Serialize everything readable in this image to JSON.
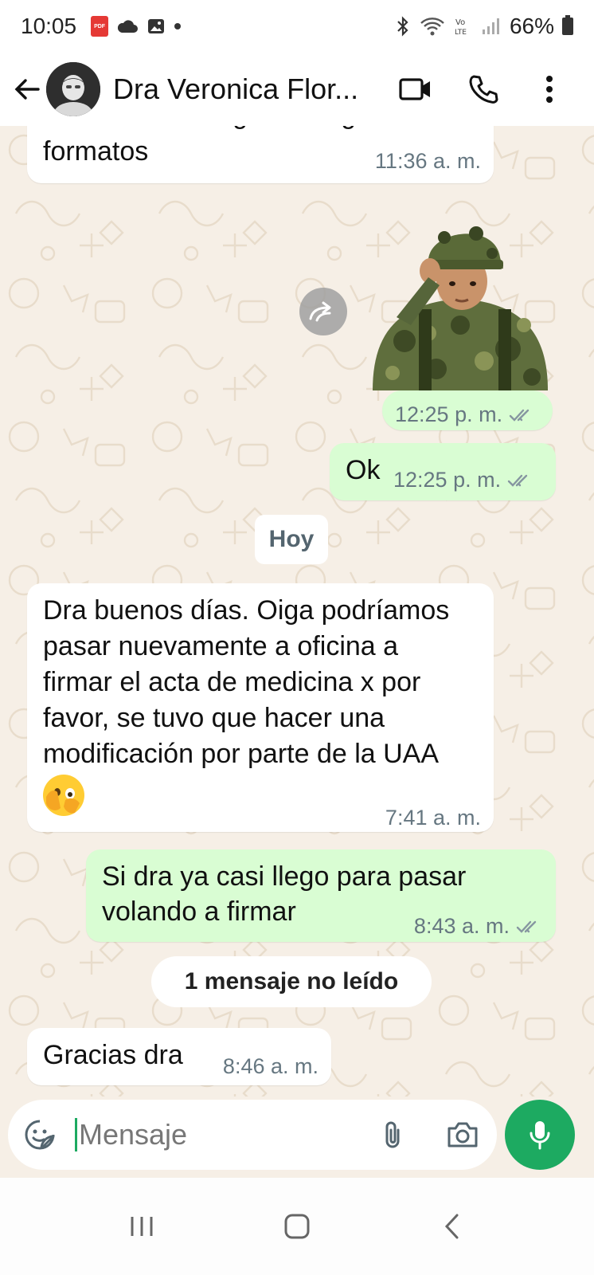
{
  "status_bar": {
    "time": "10:05",
    "battery": "66%"
  },
  "header": {
    "contact_name": "Dra Veronica Flor...",
    "accent_color": "#1daa61"
  },
  "messages": [
    {
      "direction": "incoming",
      "partial_top": "ustedes solo háganos llegar los",
      "text": "formatos",
      "time": "11:36 a. m."
    },
    {
      "direction": "outgoing",
      "type": "sticker",
      "sticker_icon": "saluting-child-soldier-sticker",
      "time": "12:25 p. m."
    },
    {
      "direction": "outgoing",
      "text": "Ok",
      "time": "12:25 p. m."
    },
    {
      "direction": "incoming",
      "lines": [
        "Dra buenos días. Oiga podríamos",
        "pasar nuevamente a oficina a",
        "firmar el acta de medicina x por",
        "favor, se tuvo que hacer una",
        "modificación por parte de la UAA"
      ],
      "emoji": "🫣",
      "time": "7:41 a. m."
    },
    {
      "direction": "outgoing",
      "lines": [
        "Si dra ya casi llego para pasar",
        "volando a firmar"
      ],
      "time": "8:43 a. m."
    },
    {
      "direction": "incoming",
      "text": "Gracias dra",
      "time": "8:46 a. m."
    }
  ],
  "date_separator": "Hoy",
  "unread_separator": "1 mensaje no leído",
  "input": {
    "placeholder": "Mensaje"
  }
}
